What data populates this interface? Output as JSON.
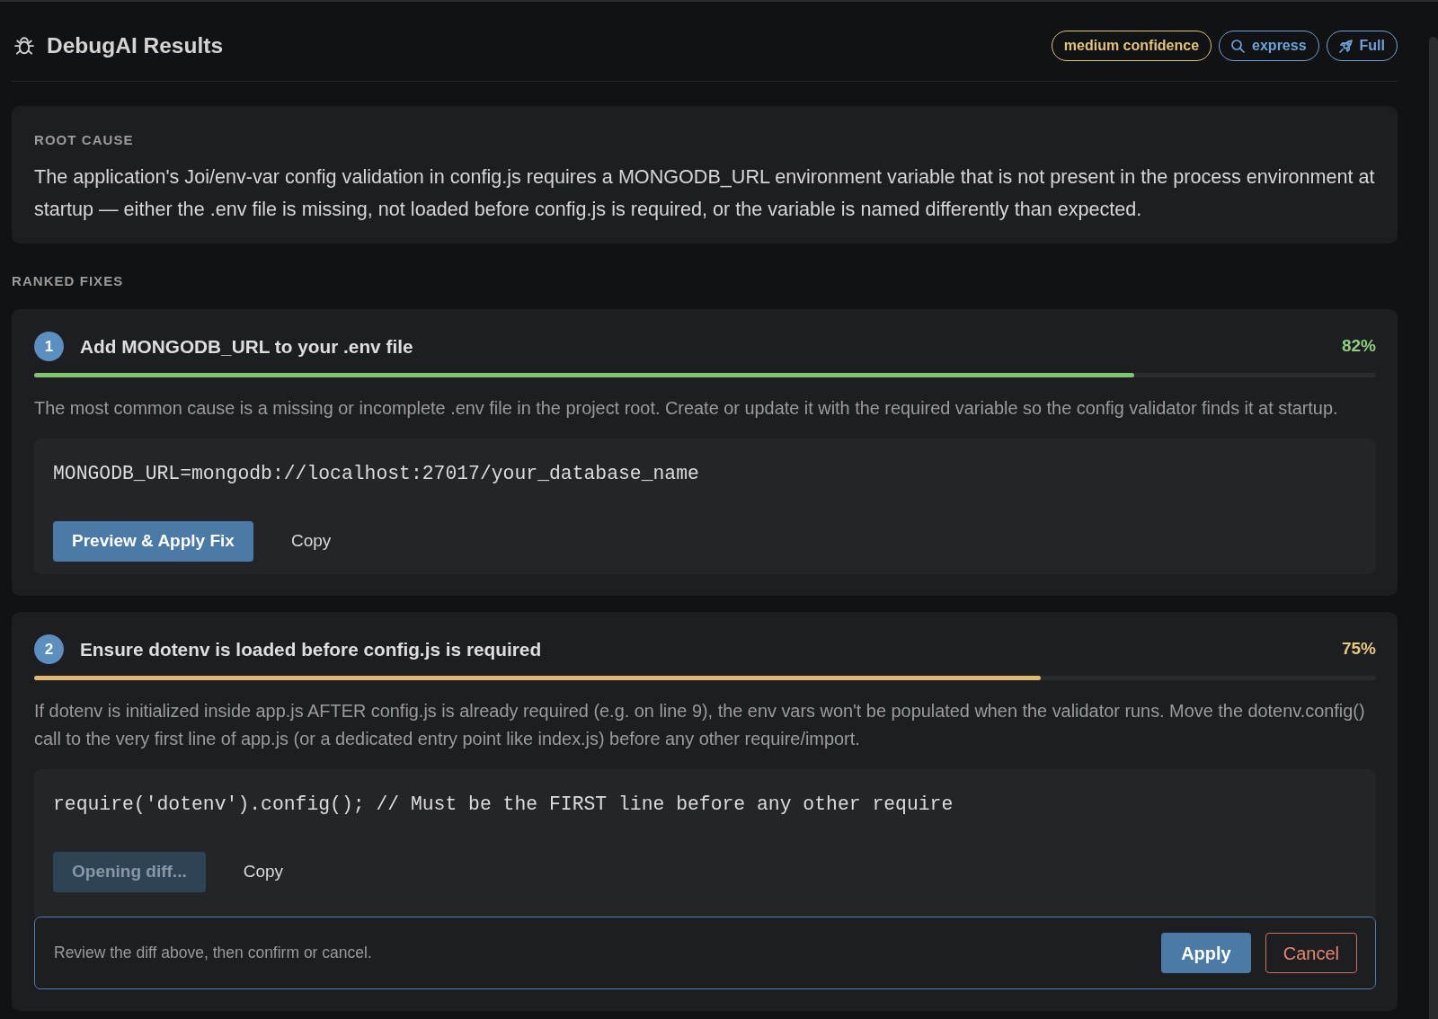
{
  "header": {
    "title": "DebugAI Results",
    "badges": [
      {
        "kind": "confidence",
        "label": "medium confidence",
        "color": "#e3c27a"
      },
      {
        "kind": "framework",
        "label": "express",
        "color": "#6fa3d6"
      },
      {
        "kind": "mode",
        "label": "Full",
        "color": "#6fa3d6"
      }
    ]
  },
  "root_cause": {
    "label": "ROOT CAUSE",
    "text": "The application's Joi/env-var config validation in config.js requires a MONGODB_URL environment variable that is not present in the process environment at startup — either the .env file is missing, not loaded before config.js is required, or the variable is named differently than expected."
  },
  "ranked_fixes": {
    "heading": "RANKED FIXES",
    "items": [
      {
        "number": "1",
        "title": "Add MONGODB_URL to your .env file",
        "confidence": "82%",
        "level": 0.82,
        "description": "The most common cause is a missing or incomplete .env file in the project root. Create or update it with the required variable so the config validator finds it at startup.",
        "code": "MONGODB_URL=mongodb://localhost:27017/your_database_name",
        "actions": [
          {
            "kind": "primary",
            "label": "Preview & Apply Fix",
            "disabled": false
          },
          {
            "kind": "copy",
            "label": "Copy",
            "disabled": false
          }
        ]
      },
      {
        "number": "2",
        "title": "Ensure dotenv is loaded before config.js is required",
        "confidence": "75%",
        "level": 0.75,
        "description": "If dotenv is initialized inside app.js AFTER config.js is already required (e.g. on line 9), the env vars won't be populated when the validator runs. Move the dotenv.config() call to the very first line of app.js (or a dedicated entry point like index.js) before any other require/import.",
        "code": "require('dotenv').config(); // Must be the FIRST line before any other require",
        "actions": [
          {
            "kind": "primary",
            "label": "Opening diff...",
            "disabled": true
          },
          {
            "kind": "copy",
            "label": "Copy",
            "disabled": false
          }
        ],
        "confirm": {
          "message": "Review the diff above, then confirm or cancel.",
          "buttons": [
            {
              "kind": "apply",
              "label": "Apply"
            },
            {
              "kind": "cancel",
              "label": "Cancel"
            }
          ]
        }
      }
    ]
  }
}
